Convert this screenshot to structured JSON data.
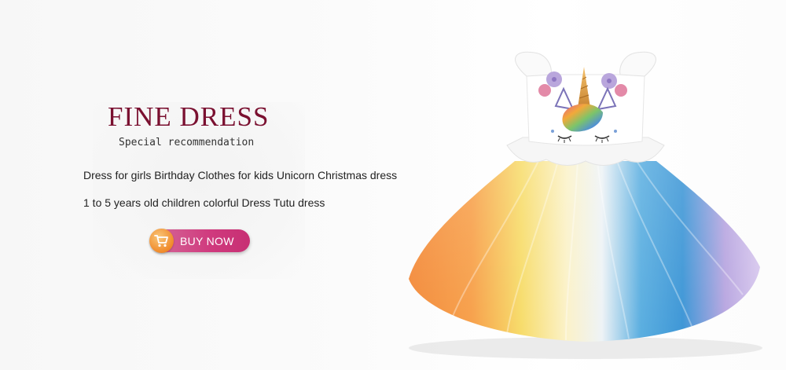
{
  "promo": {
    "title": "FINE DRESS",
    "subtitle": "Special recommendation",
    "description_line1": "Dress for girls  Birthday Clothes for kids Unicorn Christmas dress",
    "description_line2": "1 to 5 years old children colorful Dress Tutu dress",
    "buy_button_label": "BUY NOW"
  },
  "colors": {
    "title": "#7a1030",
    "button_pink": "#d03a7e",
    "cart_orange": "#f08a2a"
  },
  "icons": {
    "cart": "shopping-cart-icon"
  },
  "product_image": "unicorn-rainbow-tutu-dress"
}
